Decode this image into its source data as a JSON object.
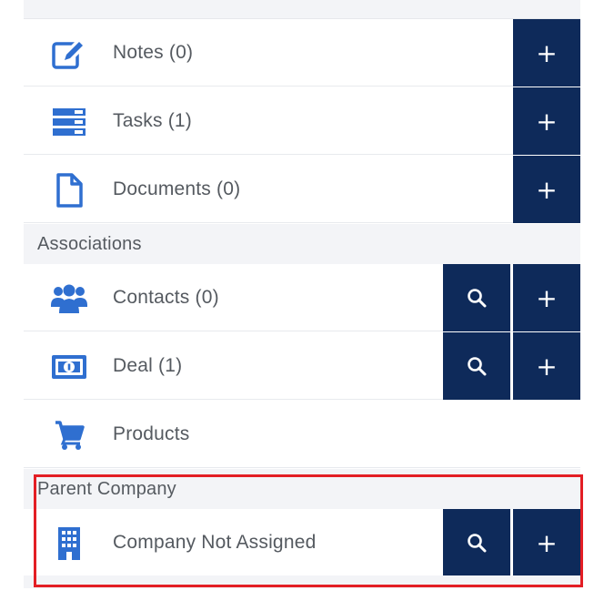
{
  "activities": [
    {
      "label": "Notes (0)",
      "icon": "edit-icon"
    },
    {
      "label": "Tasks (1)",
      "icon": "tasks-icon"
    },
    {
      "label": "Documents (0)",
      "icon": "document-icon"
    }
  ],
  "associations_header": "Associations",
  "associations": [
    {
      "label": "Contacts (0)",
      "icon": "contacts-icon"
    },
    {
      "label": "Deal (1)",
      "icon": "deal-icon"
    },
    {
      "label": "Products",
      "icon": "cart-icon"
    }
  ],
  "parent_company_header": "Parent Company",
  "parent_company": {
    "label": "Company Not Assigned",
    "icon": "building-icon"
  },
  "buttons": {
    "add_symbol": "+",
    "search_icon": "search-icon"
  },
  "colors": {
    "button_bg": "#0e2a5a",
    "icon_blue": "#2f6fd0",
    "highlight": "#e31e24",
    "text": "#555a60",
    "section_bg": "#f3f4f7"
  }
}
